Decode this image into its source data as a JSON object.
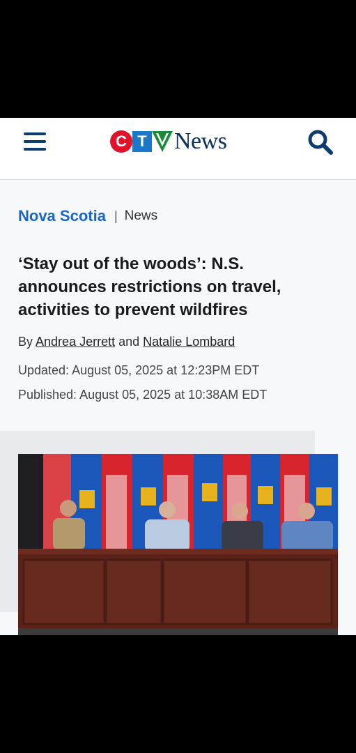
{
  "header": {
    "menu_icon": "hamburger-menu-icon",
    "logo": {
      "c": "C",
      "t": "T",
      "v": "V",
      "news": "News"
    },
    "search_icon": "search-icon"
  },
  "article": {
    "section": "Nova Scotia",
    "separator": "|",
    "category": "News",
    "title": "‘Stay out of the woods’: N.S. announces restrictions on travel, activities to prevent wildfires",
    "byline": {
      "prefix": "By",
      "author1": "Andrea Jerrett",
      "conjunction": "and",
      "author2": "Natalie Lombard"
    },
    "updated": "Updated: August 05, 2025 at 12:23PM EDT",
    "published": "Published: August 05, 2025 at 10:38AM EDT"
  },
  "colors": {
    "section_link": "#1a66c8",
    "logo_red": "#e3122b",
    "logo_blue": "#1b78c8",
    "logo_news": "#0b2f5c",
    "nav_icon": "#0b3d6e"
  }
}
